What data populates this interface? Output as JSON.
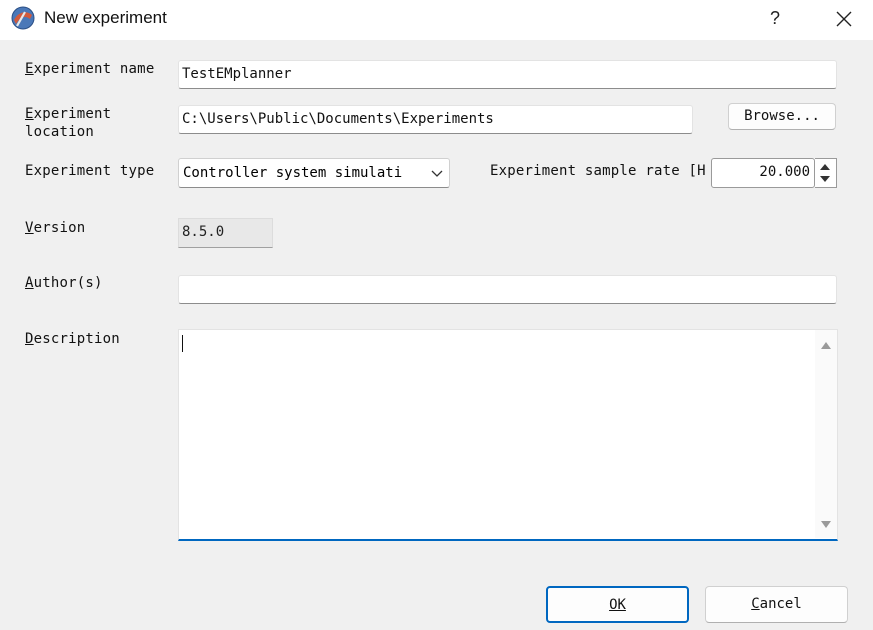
{
  "window": {
    "title": "New experiment",
    "help_label": "?",
    "close_icon": "close-icon"
  },
  "form": {
    "name_label_u": "E",
    "name_label_rest": "xperiment name",
    "name_value": "TestEMplanner",
    "location_label_line1_u": "E",
    "location_label_line1_rest": "xperiment",
    "location_label_line2": "location",
    "location_value": "C:\\Users\\Public\\Documents\\Experiments",
    "browse_label": "Browse...",
    "type_label": "Experiment type",
    "type_value": "Controller system simulati",
    "sample_rate_label": "Experiment sample rate [H",
    "sample_rate_value": "20.000",
    "version_label_u": "V",
    "version_label_rest": "ersion",
    "version_value": "8.5.0",
    "authors_label_u": "A",
    "authors_label_rest": "uthor(s)",
    "authors_value": "",
    "description_label_u": "D",
    "description_label_rest": "escription",
    "description_value": ""
  },
  "buttons": {
    "ok_label": "OK",
    "cancel_label_u": "C",
    "cancel_label_rest": "ancel"
  },
  "colors": {
    "accent": "#0067c0",
    "background": "#f0f0f0"
  }
}
